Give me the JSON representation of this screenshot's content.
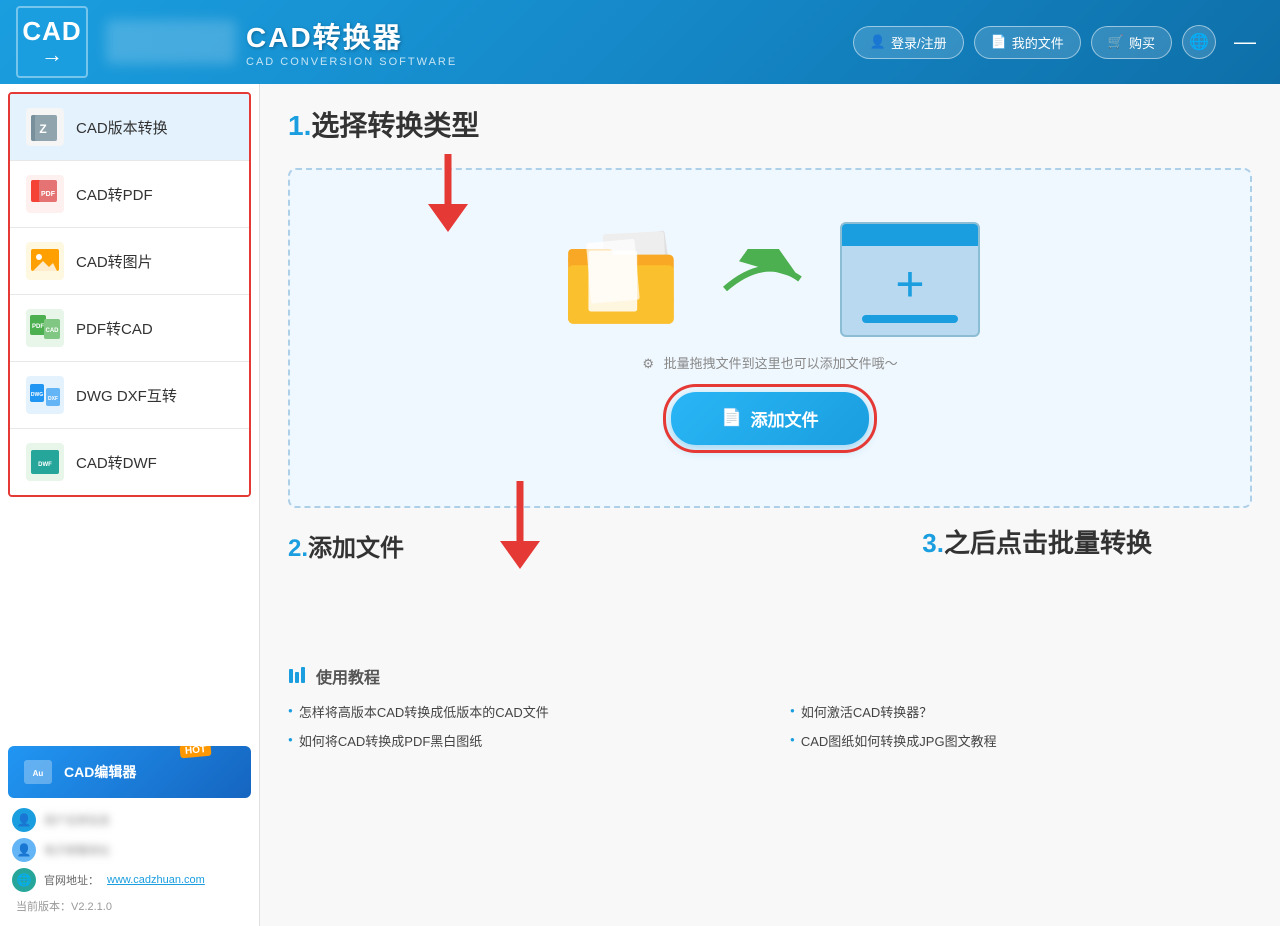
{
  "header": {
    "logo_cad": "CAD",
    "logo_arrow": "→",
    "logo_blurred": "",
    "app_title": "CAD转换器",
    "app_subtitle": "CAD CONVERSION SOFTWARE",
    "btn_login": "登录/注册",
    "btn_myfiles": "我的文件",
    "btn_buy": "购买",
    "btn_minus": "—"
  },
  "sidebar": {
    "items": [
      {
        "id": "version",
        "label": "CAD版本转换",
        "icon": "version"
      },
      {
        "id": "to-pdf",
        "label": "CAD转PDF",
        "icon": "pdf"
      },
      {
        "id": "to-img",
        "label": "CAD转图片",
        "icon": "img"
      },
      {
        "id": "from-pdf",
        "label": "PDF转CAD",
        "icon": "fromPdf"
      },
      {
        "id": "dwg-dxf",
        "label": "DWG DXF互转",
        "icon": "dwgdxf"
      },
      {
        "id": "to-dwf",
        "label": "CAD转DWF",
        "icon": "dwf"
      }
    ],
    "editor_banner": "CAD编辑器",
    "hot_badge": "HOT",
    "info": {
      "website_label": "官网地址：",
      "website_url": "www.cadzhuan.com",
      "version_label": "当前版本：V2.2.1.0"
    }
  },
  "main": {
    "step1_title": "1.选择转换类型",
    "step2_title": "2.添加文件",
    "step3_title": "3.之后点击批量转换",
    "drop_hint": "批量拖拽文件到这里也可以添加文件哦～",
    "add_file_btn": "添加文件",
    "tutorial_header": "使用教程",
    "tutorial_links": [
      "怎样将高版本CAD转换成低版本的CAD文件",
      "如何将CAD转换成PDF黑白图纸",
      "如何激活CAD转换器？",
      "CAD图纸如何转换成JPG图文教程"
    ]
  }
}
